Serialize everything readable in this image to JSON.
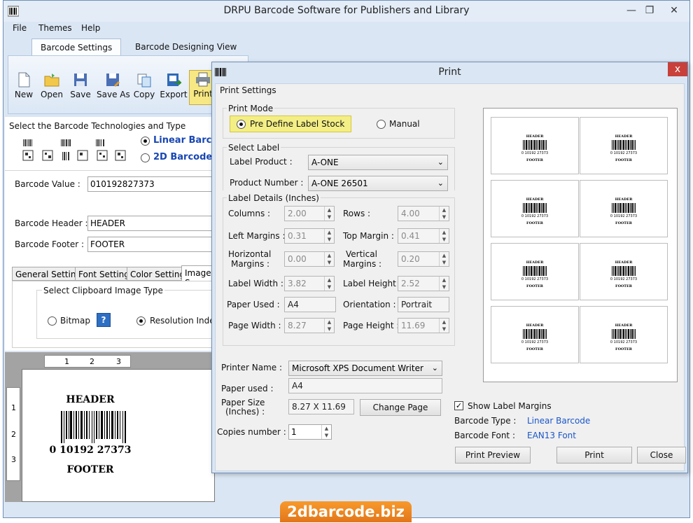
{
  "app": {
    "title": "DRPU Barcode Software for Publishers and Library",
    "menu": [
      "File",
      "Themes",
      "Help"
    ],
    "tabs": [
      "Barcode Settings",
      "Barcode Designing View"
    ],
    "ribbon": [
      "New",
      "Open",
      "Save",
      "Save As",
      "Copy",
      "Export",
      "Print"
    ]
  },
  "left": {
    "tech_label": "Select the Barcode Technologies and Type",
    "linear_label": "Linear Barcode",
    "twod_label": "2D Barcode",
    "value_label": "Barcode Value :",
    "value": "010192827373",
    "header_label": "Barcode Header :",
    "header": "HEADER",
    "footer_label": "Barcode Footer :",
    "footer": "FOOTER",
    "subtabs": [
      "General Settings",
      "Font Settings",
      "Color Settings",
      "Image Se"
    ],
    "clip_group": "Select Clipboard Image Type",
    "bitmap": "Bitmap",
    "help_glyph": "?",
    "resolution": "Resolution Independ"
  },
  "canvas": {
    "ruler_top": [
      "1",
      "2",
      "3"
    ],
    "ruler_left": [
      "1",
      "2",
      "3"
    ],
    "header": "HEADER",
    "number": "0 10192 27373",
    "footer": "FOOTER"
  },
  "dialog": {
    "title": "Print",
    "close_glyph": "x",
    "print_settings": "Print Settings",
    "print_mode": "Print Mode",
    "predefine": "Pre Define Label Stock",
    "manual": "Manual",
    "select_label": "Select Label",
    "label_product_label": "Label Product :",
    "label_product": "A-ONE",
    "product_number_label": "Product Number :",
    "product_number": "A-ONE 26501",
    "label_details": "Label Details (Inches)",
    "columns_label": "Columns :",
    "columns": "2.00",
    "rows_label": "Rows :",
    "rows": "4.00",
    "left_margins_label": "Left Margins :",
    "left_margins": "0.31",
    "top_margin_label": "Top Margin :",
    "top_margin": "0.41",
    "horizontal_margins_label_1": "Horizontal",
    "horizontal_margins_label_2": "Margins :",
    "horizontal_margins": "0.00",
    "vertical_margins_label_1": "Vertical",
    "vertical_margins_label_2": "Margins :",
    "vertical_margins": "0.20",
    "label_width_label": "Label Width :",
    "label_width": "3.82",
    "label_height_label": "Label Height :",
    "label_height": "2.52",
    "paper_used_label": "Paper Used :",
    "paper_used": "A4",
    "orientation_label": "Orientation :",
    "orientation": "Portrait",
    "page_width_label": "Page Width :",
    "page_width": "8.27",
    "page_height_label": "Page Height :",
    "page_height": "11.69",
    "printer_name_label": "Printer Name :",
    "printer_name": "Microsoft XPS Document Writer",
    "paper_used2_label": "Paper used :",
    "paper_used2": "A4",
    "paper_size_label_1": "Paper Size",
    "paper_size_label_2": "(Inches) :",
    "paper_size": "8.27 X 11.69",
    "change_page": "Change Page",
    "copies_label": "Copies number :",
    "copies": "1",
    "show_margins": "Show Label Margins",
    "barcode_type_label": "Barcode Type :",
    "barcode_type": "Linear Barcode",
    "barcode_font_label": "Barcode Font :",
    "barcode_font": "EAN13 Font",
    "print_preview": "Print Preview",
    "print": "Print",
    "close": "Close",
    "preview_label": {
      "header": "HEADER",
      "number": "0 10192 27373",
      "footer": "FOOTER"
    }
  },
  "watermark": "2dbarcode.biz",
  "colors": {
    "window_bg": "#dbe6f4",
    "highlight": "#f3ef86",
    "link": "#1a56c8",
    "close_red": "#c9403a",
    "watermark": "#f08a24"
  }
}
